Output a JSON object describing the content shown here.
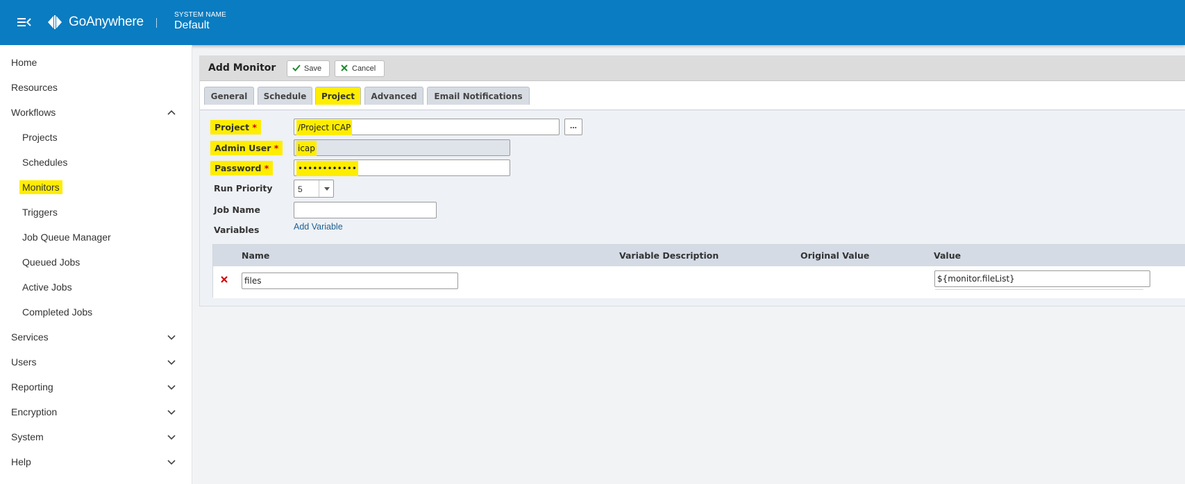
{
  "header": {
    "brand": "GoAnywhere",
    "system_name_label": "SYSTEM NAME",
    "system_name_value": "Default",
    "bg_color": "#0a7cc1"
  },
  "sidebar": {
    "items": [
      {
        "label": "Home",
        "level": "top",
        "chevron": "none"
      },
      {
        "label": "Resources",
        "level": "top",
        "chevron": "none"
      },
      {
        "label": "Workflows",
        "level": "top",
        "chevron": "up"
      },
      {
        "label": "Projects",
        "level": "sub",
        "chevron": "none"
      },
      {
        "label": "Schedules",
        "level": "sub",
        "chevron": "none"
      },
      {
        "label": "Monitors",
        "level": "sub",
        "chevron": "none",
        "active": true
      },
      {
        "label": "Triggers",
        "level": "sub",
        "chevron": "none"
      },
      {
        "label": "Job Queue Manager",
        "level": "sub",
        "chevron": "none"
      },
      {
        "label": "Queued Jobs",
        "level": "sub",
        "chevron": "none"
      },
      {
        "label": "Active Jobs",
        "level": "sub",
        "chevron": "none"
      },
      {
        "label": "Completed Jobs",
        "level": "sub",
        "chevron": "none"
      },
      {
        "label": "Services",
        "level": "top",
        "chevron": "down"
      },
      {
        "label": "Users",
        "level": "top",
        "chevron": "down"
      },
      {
        "label": "Reporting",
        "level": "top",
        "chevron": "down"
      },
      {
        "label": "Encryption",
        "level": "top",
        "chevron": "down"
      },
      {
        "label": "System",
        "level": "top",
        "chevron": "down"
      },
      {
        "label": "Help",
        "level": "top",
        "chevron": "down"
      }
    ]
  },
  "page": {
    "title": "Add Monitor",
    "save_label": "Save",
    "cancel_label": "Cancel"
  },
  "tabs": [
    {
      "label": "General"
    },
    {
      "label": "Schedule"
    },
    {
      "label": "Project",
      "active": true
    },
    {
      "label": "Advanced"
    },
    {
      "label": "Email Notifications"
    }
  ],
  "form": {
    "project_label": "Project",
    "project_value": "/Project ICAP",
    "browse_label": "...",
    "admin_user_label": "Admin User",
    "admin_user_value": "icap",
    "password_label": "Password",
    "password_value": "••••••••••••",
    "run_priority_label": "Run Priority",
    "run_priority_value": "5",
    "job_name_label": "Job Name",
    "job_name_value": "",
    "variables_label": "Variables",
    "add_variable_label": "Add Variable",
    "required_mark": "*"
  },
  "variables_table": {
    "columns": [
      "Name",
      "Variable Description",
      "Original Value",
      "Value"
    ],
    "rows": [
      {
        "name": "files",
        "description": "",
        "original_value": "",
        "value": "${monitor.fileList}"
      }
    ]
  },
  "colors": {
    "highlight": "#ffed00",
    "required_star": "#d10000",
    "link": "#1d5f91",
    "save_check": "#1b8a2c",
    "cancel_x": "#1b8a2c",
    "delete_x": "#d10000"
  }
}
